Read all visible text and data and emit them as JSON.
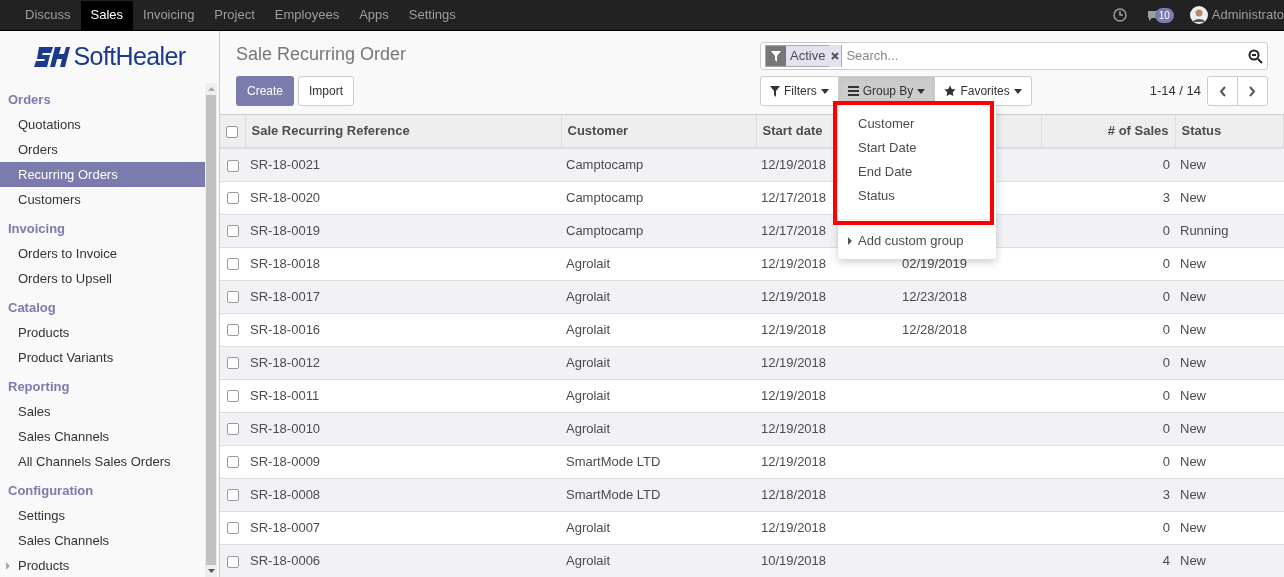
{
  "top_menu": [
    {
      "label": "Discuss",
      "selected": false
    },
    {
      "label": "Sales",
      "selected": true
    },
    {
      "label": "Invoicing",
      "selected": false
    },
    {
      "label": "Project",
      "selected": false
    },
    {
      "label": "Employees",
      "selected": false
    },
    {
      "label": "Apps",
      "selected": false
    },
    {
      "label": "Settings",
      "selected": false
    }
  ],
  "messages_badge": "10",
  "user": "Administrato",
  "logo": {
    "text": "SoftHealer"
  },
  "sidebar": [
    {
      "title": "Orders",
      "items": [
        {
          "label": "Quotations",
          "selected": false,
          "expandable": false
        },
        {
          "label": "Orders",
          "selected": false,
          "expandable": false
        },
        {
          "label": "Recurring Orders",
          "selected": true,
          "expandable": false
        },
        {
          "label": "Customers",
          "selected": false,
          "expandable": false
        }
      ]
    },
    {
      "title": "Invoicing",
      "items": [
        {
          "label": "Orders to Invoice",
          "selected": false,
          "expandable": false
        },
        {
          "label": "Orders to Upsell",
          "selected": false,
          "expandable": false
        }
      ]
    },
    {
      "title": "Catalog",
      "items": [
        {
          "label": "Products",
          "selected": false,
          "expandable": false
        },
        {
          "label": "Product Variants",
          "selected": false,
          "expandable": false
        }
      ]
    },
    {
      "title": "Reporting",
      "items": [
        {
          "label": "Sales",
          "selected": false,
          "expandable": false
        },
        {
          "label": "Sales Channels",
          "selected": false,
          "expandable": false
        },
        {
          "label": "All Channels Sales Orders",
          "selected": false,
          "expandable": false
        }
      ]
    },
    {
      "title": "Configuration",
      "items": [
        {
          "label": "Settings",
          "selected": false,
          "expandable": false
        },
        {
          "label": "Sales Channels",
          "selected": false,
          "expandable": false
        },
        {
          "label": "Products",
          "selected": false,
          "expandable": true
        }
      ]
    }
  ],
  "page_title": "Sale Recurring Order",
  "buttons": {
    "create": "Create",
    "import": "Import"
  },
  "search": {
    "facet": "Active",
    "placeholder": "Search..."
  },
  "search_options": [
    {
      "label": "Filters",
      "selected": false
    },
    {
      "label": "Group By",
      "selected": true
    },
    {
      "label": "Favorites",
      "selected": false
    }
  ],
  "pager": "1-14 / 14",
  "table": {
    "all_checked": false,
    "columns": [
      "Sale Recurring Reference",
      "Customer",
      "Start date",
      "",
      "# of Sales",
      "Status"
    ],
    "rows": [
      {
        "reference": "SR-18-0021",
        "customer": "Camptocamp",
        "start_date": "12/19/2018",
        "end_date": "",
        "sales": "0",
        "status": "New",
        "checked": false
      },
      {
        "reference": "SR-18-0020",
        "customer": "Camptocamp",
        "start_date": "12/17/2018",
        "end_date": "",
        "sales": "3",
        "status": "New",
        "checked": false
      },
      {
        "reference": "SR-18-0019",
        "customer": "Camptocamp",
        "start_date": "12/17/2018",
        "end_date": "",
        "sales": "0",
        "status": "Running",
        "checked": false
      },
      {
        "reference": "SR-18-0018",
        "customer": "Agrolait",
        "start_date": "12/19/2018",
        "end_date": "02/19/2019",
        "sales": "0",
        "status": "New",
        "checked": false
      },
      {
        "reference": "SR-18-0017",
        "customer": "Agrolait",
        "start_date": "12/19/2018",
        "end_date": "12/23/2018",
        "sales": "0",
        "status": "New",
        "checked": false
      },
      {
        "reference": "SR-18-0016",
        "customer": "Agrolait",
        "start_date": "12/19/2018",
        "end_date": "12/28/2018",
        "sales": "0",
        "status": "New",
        "checked": false
      },
      {
        "reference": "SR-18-0012",
        "customer": "Agrolait",
        "start_date": "12/19/2018",
        "end_date": "",
        "sales": "0",
        "status": "New",
        "checked": false
      },
      {
        "reference": "SR-18-0011",
        "customer": "Agrolait",
        "start_date": "12/19/2018",
        "end_date": "",
        "sales": "0",
        "status": "New",
        "checked": false
      },
      {
        "reference": "SR-18-0010",
        "customer": "Agrolait",
        "start_date": "12/19/2018",
        "end_date": "",
        "sales": "0",
        "status": "New",
        "checked": false
      },
      {
        "reference": "SR-18-0009",
        "customer": "SmartMode LTD",
        "start_date": "12/19/2018",
        "end_date": "",
        "sales": "0",
        "status": "New",
        "checked": false
      },
      {
        "reference": "SR-18-0008",
        "customer": "SmartMode LTD",
        "start_date": "12/18/2018",
        "end_date": "",
        "sales": "3",
        "status": "New",
        "checked": false
      },
      {
        "reference": "SR-18-0007",
        "customer": "Agrolait",
        "start_date": "12/19/2018",
        "end_date": "",
        "sales": "0",
        "status": "New",
        "checked": false
      },
      {
        "reference": "SR-18-0006",
        "customer": "Agrolait",
        "start_date": "10/19/2018",
        "end_date": "",
        "sales": "4",
        "status": "New",
        "checked": false
      }
    ]
  },
  "group_by_menu": {
    "options": [
      "Customer",
      "Start Date",
      "End Date",
      "Status"
    ],
    "custom": "Add custom group",
    "highlighted": true
  }
}
